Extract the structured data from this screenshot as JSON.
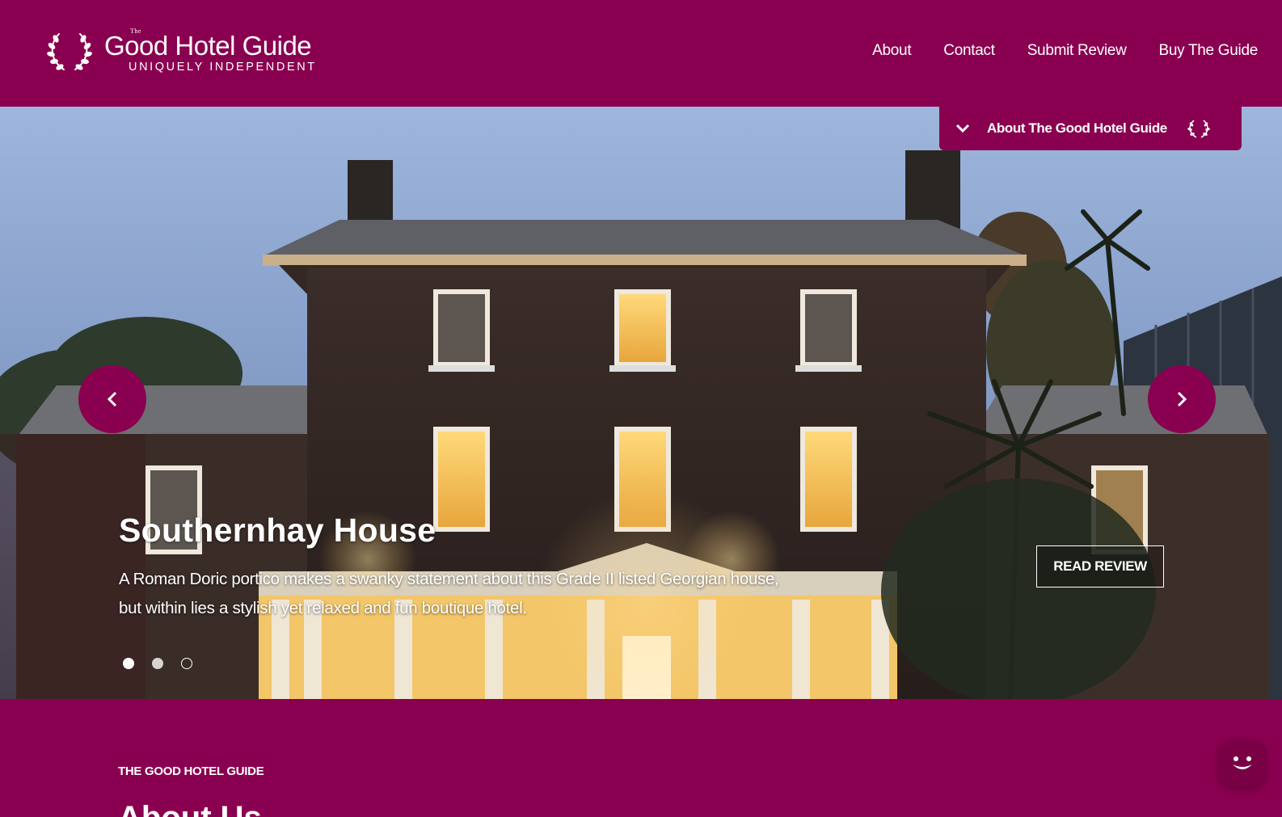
{
  "header": {
    "logo": {
      "small_word": "The",
      "title": "Good Hotel Guide",
      "tagline": "UNIQUELY INDEPENDENT"
    },
    "nav": [
      {
        "label": "About"
      },
      {
        "label": "Contact"
      },
      {
        "label": "Submit Review"
      },
      {
        "label": "Buy The Guide"
      }
    ]
  },
  "about_tab": {
    "label": "About The Good Hotel Guide",
    "icon_left": "chevron-down-icon",
    "icon_right": "laurel-wreath-icon"
  },
  "slider": {
    "current_slide": 1,
    "total_slides": 3,
    "title": "Southernhay House",
    "description": "A Roman Doric portico makes a swanky statement about this Grade II listed Georgian house, but within lies a stylish yet relaxed and fun boutique hotel.",
    "cta": "READ REVIEW",
    "prev_icon": "chevron-left-icon",
    "next_icon": "chevron-right-icon"
  },
  "section": {
    "label": "THE GOOD HOTEL GUIDE",
    "heading": "About Us"
  },
  "chat": {
    "icon": "chat-smile-icon"
  },
  "colors": {
    "brand": "#8a0050",
    "text": "#ffffff"
  }
}
